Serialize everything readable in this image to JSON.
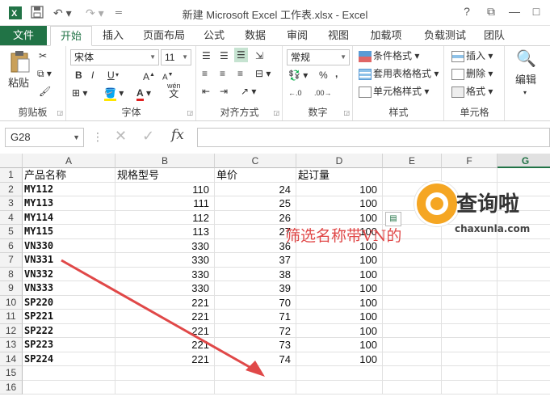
{
  "window": {
    "title": "新建 Microsoft Excel 工作表.xlsx - Excel",
    "help": "?",
    "restore": "⧉",
    "minimize": "—",
    "maximize": "□"
  },
  "tabs": [
    "文件",
    "开始",
    "插入",
    "页面布局",
    "公式",
    "数据",
    "审阅",
    "视图",
    "加载项",
    "负载测试",
    "团队"
  ],
  "active_tab_index": 1,
  "ribbon": {
    "clipboard": {
      "label": "剪贴板",
      "paste": "粘贴"
    },
    "font": {
      "label": "字体",
      "name": "宋体",
      "size": "11",
      "bold": "B",
      "italic": "I",
      "underline": "U",
      "grow": "A",
      "shrink": "A",
      "wen": "wén",
      "wen_char": "文"
    },
    "alignment": {
      "label": "对齐方式"
    },
    "number": {
      "label": "数字",
      "format": "常规",
      "percent": "%",
      "comma": ","
    },
    "styles": {
      "label": "样式",
      "cond_format": "条件格式",
      "table_format": "套用表格格式",
      "cell_styles": "单元格样式"
    },
    "cells": {
      "label": "单元格",
      "insert": "插入",
      "delete": "删除",
      "format": "格式"
    },
    "editing": {
      "label": "编辑"
    }
  },
  "formula_bar": {
    "name_box": "G28",
    "fx": "fx",
    "cancel": "✕",
    "enter": "✓",
    "value": ""
  },
  "columns": [
    "A",
    "B",
    "C",
    "D",
    "E",
    "F",
    "G"
  ],
  "selected_column": "G",
  "rows": [
    "1",
    "2",
    "3",
    "4",
    "5",
    "6",
    "7",
    "8",
    "9",
    "10",
    "11",
    "12",
    "13",
    "14",
    "15",
    "16"
  ],
  "table": {
    "headers": [
      "产品名称",
      "规格型号",
      "单价",
      "起订量"
    ],
    "data": [
      [
        "MY112",
        "110",
        "24",
        "100"
      ],
      [
        "MY113",
        "111",
        "25",
        "100"
      ],
      [
        "MY114",
        "112",
        "26",
        "100"
      ],
      [
        "MY115",
        "113",
        "27",
        "100"
      ],
      [
        "VN330",
        "330",
        "36",
        "100"
      ],
      [
        "VN331",
        "330",
        "37",
        "100"
      ],
      [
        "VN332",
        "330",
        "38",
        "100"
      ],
      [
        "VN333",
        "330",
        "39",
        "100"
      ],
      [
        "SP220",
        "221",
        "70",
        "100"
      ],
      [
        "SP221",
        "221",
        "71",
        "100"
      ],
      [
        "SP222",
        "221",
        "72",
        "100"
      ],
      [
        "SP223",
        "221",
        "73",
        "100"
      ],
      [
        "SP224",
        "221",
        "74",
        "100"
      ]
    ]
  },
  "annotation": "筛选名称带VN的",
  "watermark": {
    "title": "查询啦",
    "subtitle": "chaxunla.com"
  },
  "colors": {
    "excel_green": "#217346",
    "arrow_red": "#e04848",
    "logo_orange": "#f5a623"
  }
}
